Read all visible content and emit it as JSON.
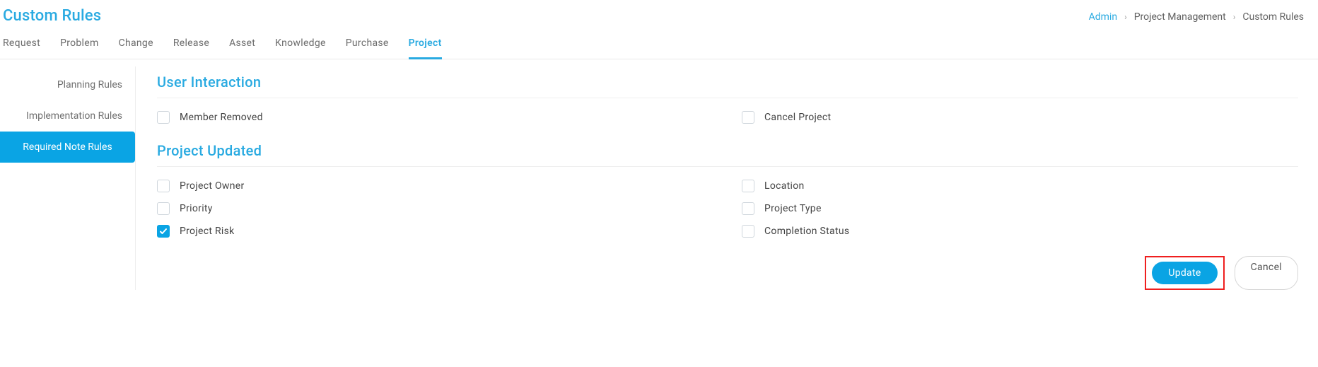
{
  "page_title": "Custom Rules",
  "breadcrumbs": [
    {
      "label": "Admin",
      "link": true
    },
    {
      "label": "Project Management",
      "link": false
    },
    {
      "label": "Custom Rules",
      "link": false
    }
  ],
  "tabs": [
    {
      "label": "Request",
      "active": false
    },
    {
      "label": "Problem",
      "active": false
    },
    {
      "label": "Change",
      "active": false
    },
    {
      "label": "Release",
      "active": false
    },
    {
      "label": "Asset",
      "active": false
    },
    {
      "label": "Knowledge",
      "active": false
    },
    {
      "label": "Purchase",
      "active": false
    },
    {
      "label": "Project",
      "active": true
    }
  ],
  "sidebar": {
    "items": [
      {
        "label": "Planning Rules",
        "active": false
      },
      {
        "label": "Implementation Rules",
        "active": false
      },
      {
        "label": "Required Note Rules",
        "active": true
      }
    ]
  },
  "sections": [
    {
      "title": "User Interaction",
      "options": [
        {
          "label": "Member Removed",
          "checked": false
        },
        {
          "label": "Cancel Project",
          "checked": false
        }
      ]
    },
    {
      "title": "Project Updated",
      "options": [
        {
          "label": "Project Owner",
          "checked": false
        },
        {
          "label": "Location",
          "checked": false
        },
        {
          "label": "Priority",
          "checked": false
        },
        {
          "label": "Project Type",
          "checked": false
        },
        {
          "label": "Project Risk",
          "checked": true
        },
        {
          "label": "Completion Status",
          "checked": false
        }
      ]
    }
  ],
  "actions": {
    "update": "Update",
    "cancel": "Cancel"
  }
}
